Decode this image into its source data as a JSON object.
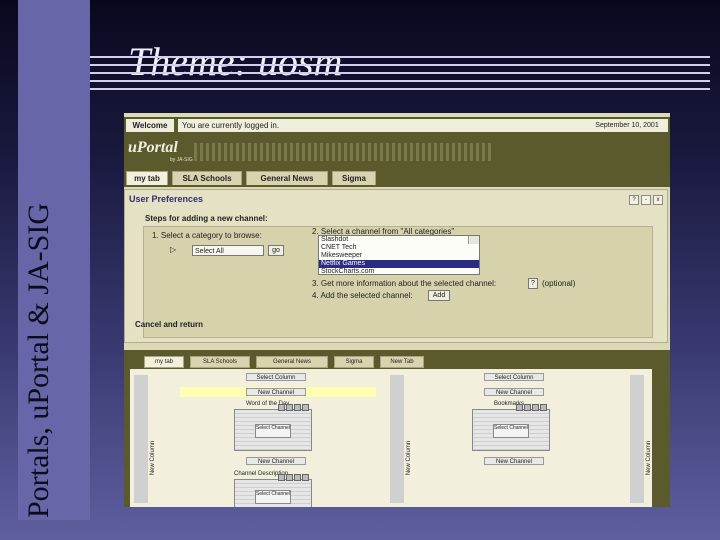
{
  "slide": {
    "vertical_title": "Portals, uPortal & JA-SIG",
    "title": "Theme: uosm"
  },
  "screenshot": {
    "topbar": {
      "welcome": "Welcome",
      "status": "You are currently logged in.",
      "date": "September 10, 2001"
    },
    "logo": {
      "name": "uPortal",
      "sub": "by JA-SIG"
    },
    "tabs": [
      "my tab",
      "SLA Schools",
      "General News",
      "Sigma"
    ],
    "active_tab_index": 0,
    "preferences": {
      "header": "User Preferences",
      "icons": [
        "?",
        "-",
        "x"
      ],
      "steps_title": "Steps for adding a new channel:",
      "step1_label": "1. Select a category to browse:",
      "step1_arrow": "▷",
      "step1_select": "Select All",
      "step1_go": "go",
      "step2_label": "2. Select a channel from \"All categories\"",
      "channels": [
        "Slashdot",
        "CNET Tech",
        "Mikesweeper",
        "Netflix Games",
        "StockCharts.com"
      ],
      "selected_channel_index": 3,
      "step3_label": "3. Get more information about the selected channel:",
      "step3_button": "?",
      "step3_optional": "(optional)",
      "step4_label": "4. Add the selected channel:",
      "step4_button": "Add",
      "cancel": "Cancel and return"
    },
    "layout": {
      "tabs": [
        "my tab",
        "SLA Schools",
        "General News",
        "Sigma",
        "New Tab"
      ],
      "active_tab_index": 0,
      "column_label": "New Column",
      "select_column": "Select Column",
      "new_channel": "New Channel",
      "channel_titles": [
        "Word of the Day",
        "Bookmarks",
        "Channel Description"
      ],
      "select_channel": "Select Channel"
    }
  }
}
